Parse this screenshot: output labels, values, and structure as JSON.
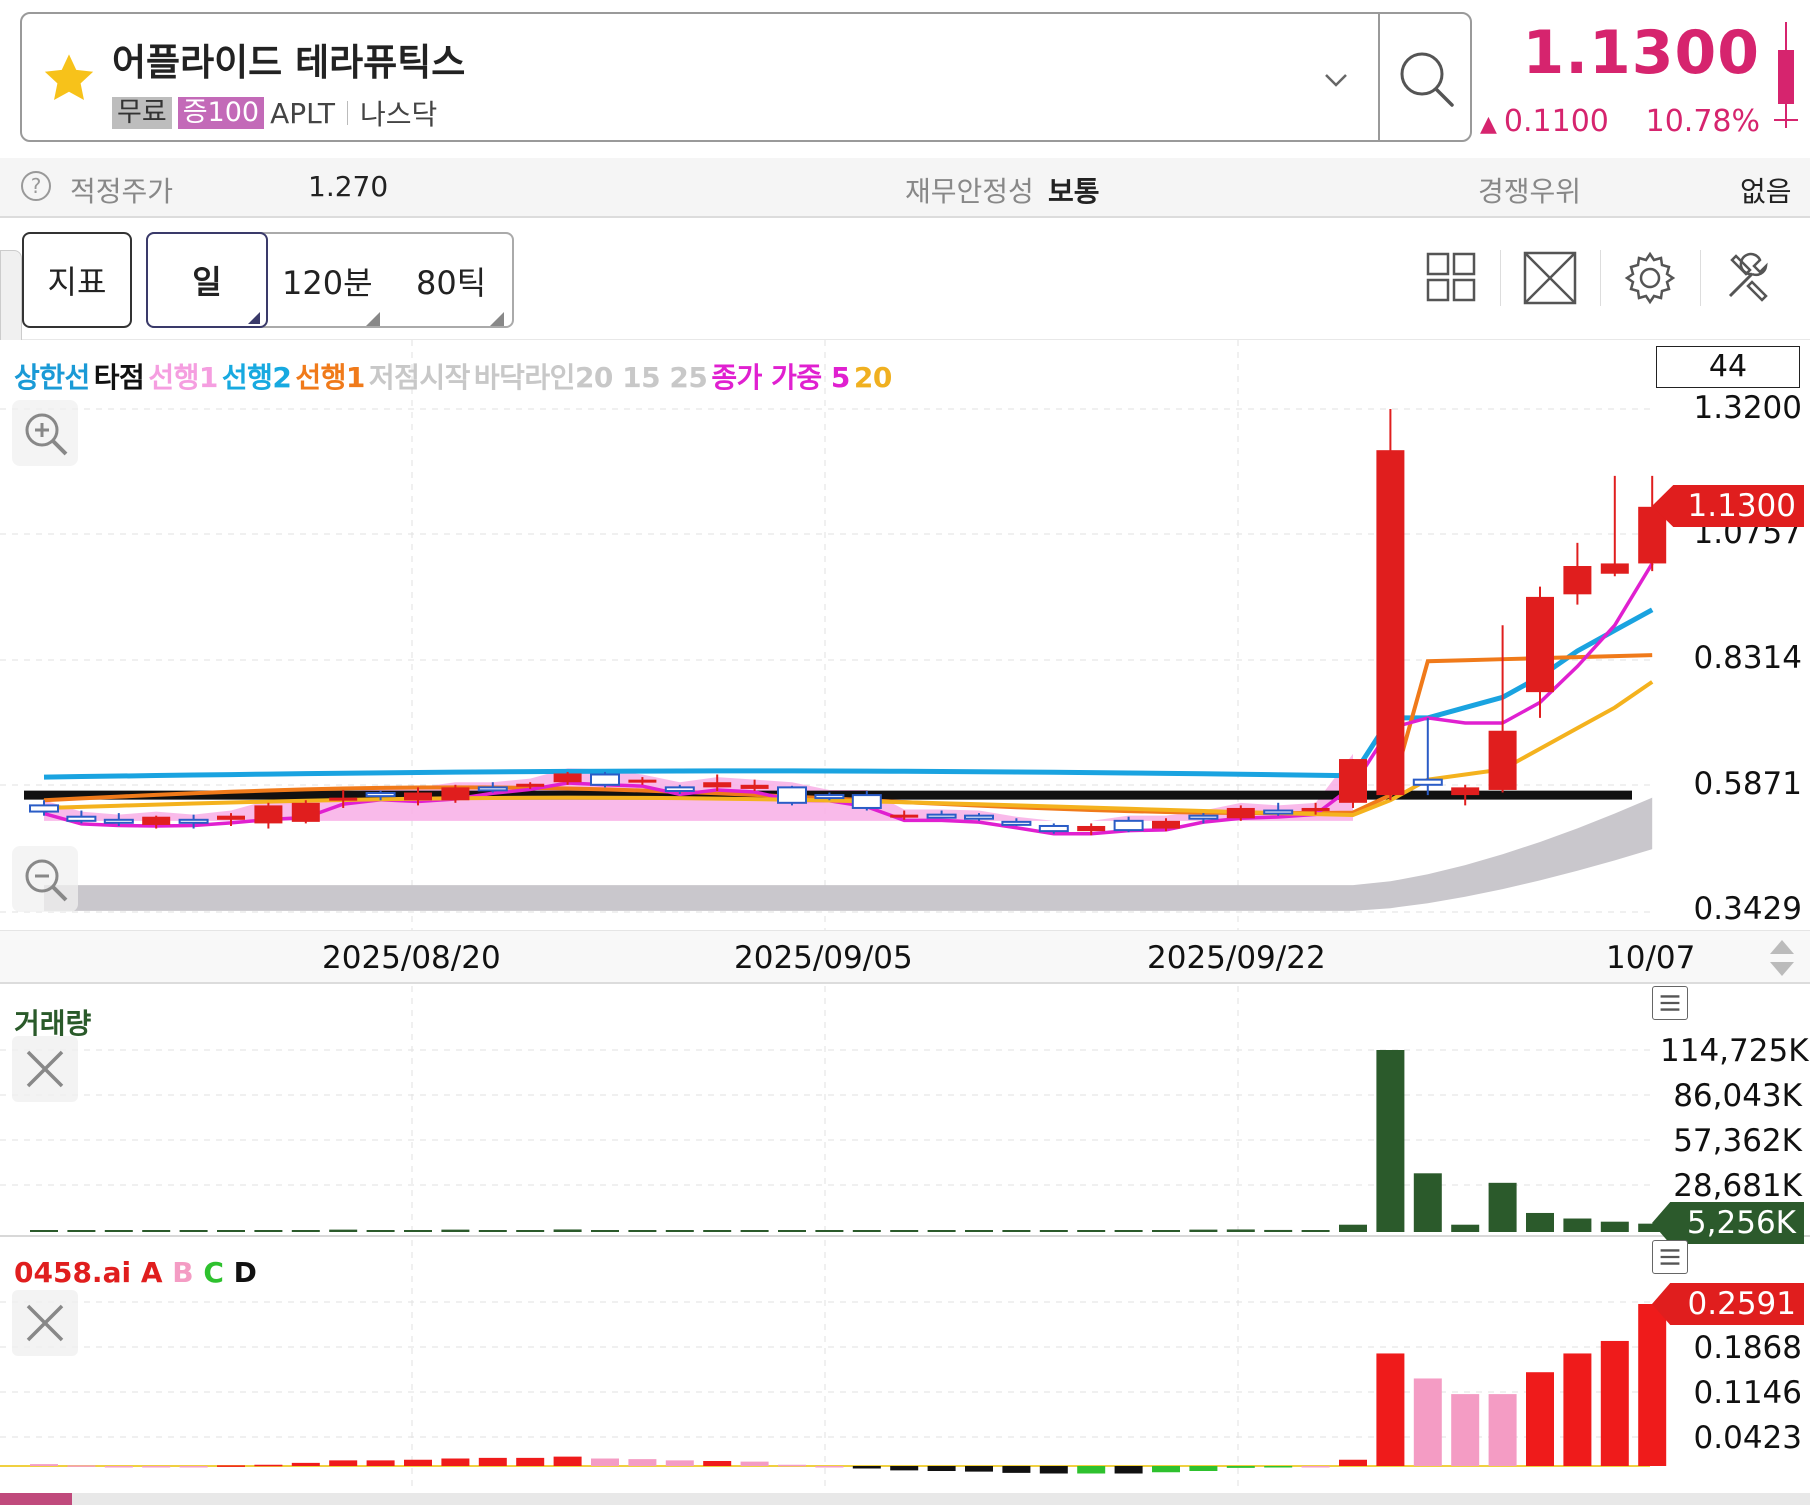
{
  "header": {
    "stock_name": "어플라이드 테라퓨틱스",
    "tag_free": "무료",
    "tag_margin": "증100",
    "ticker": "APLT",
    "market": "나스닥",
    "price": "1.1300",
    "change": "0.1100",
    "change_pct": "10.78%",
    "accent_color": "#d6246e"
  },
  "info_row": {
    "fair_price_label": "적정주가",
    "fair_price_value": "1.270",
    "financial_label": "재무안정성",
    "financial_value": "보통",
    "competition_label": "경쟁우위",
    "competition_value": "없음"
  },
  "toolbar": {
    "indicator_label": "지표",
    "period_day": "일",
    "period_120": "120분",
    "period_80": "80틱",
    "icons": [
      "layout-grid-icon",
      "fullscreen-icon",
      "gear-icon",
      "tools-icon"
    ]
  },
  "price_chart": {
    "legend": [
      {
        "text": "상한선",
        "color": "#1a9ad6"
      },
      {
        "text": "타점",
        "color": "#111111"
      },
      {
        "text": "선행1",
        "color": "#f59ee0"
      },
      {
        "text": "선행2",
        "color": "#17a9e0"
      },
      {
        "text": "선행1",
        "color": "#f07a1a"
      },
      {
        "text": "저점시작",
        "color": "#c8c8c8"
      },
      {
        "text": "바닥라인20 15 25",
        "color": "#c8c8c8"
      },
      {
        "text": "종가 가중 5",
        "color": "#e020d0"
      },
      {
        "text": "20",
        "color": "#f0b020"
      }
    ],
    "count_box": "44",
    "price_labels": [
      "1.3200",
      "1.0757",
      "0.8314",
      "0.5871",
      "0.3429"
    ],
    "current_flag": "1.1300",
    "dates": [
      "2025/08/20",
      "2025/09/05",
      "2025/09/22",
      "10/07"
    ]
  },
  "volume_chart": {
    "title": "거래량",
    "labels": [
      "114,725K",
      "86,043K",
      "57,362K",
      "28,681K"
    ],
    "current_flag": "5,256K"
  },
  "ai_chart": {
    "title_main": "0458.ai",
    "title_a": "A",
    "title_b": "B",
    "title_c": "C",
    "title_d": "D",
    "labels": [
      "0.1868",
      "0.1146",
      "0.0423"
    ],
    "current_flag": "0.2591"
  },
  "chart_data": [
    {
      "type": "candlestick",
      "ylim": [
        0.3429,
        1.32
      ],
      "candles": [
        {
          "o": 0.55,
          "h": 0.56,
          "l": 0.53,
          "c": 0.538,
          "dir": "down"
        },
        {
          "o": 0.528,
          "h": 0.54,
          "l": 0.515,
          "c": 0.52,
          "dir": "down"
        },
        {
          "o": 0.52,
          "h": 0.535,
          "l": 0.51,
          "c": 0.522,
          "dir": "down"
        },
        {
          "o": 0.512,
          "h": 0.53,
          "l": 0.505,
          "c": 0.528,
          "dir": "up"
        },
        {
          "o": 0.52,
          "h": 0.532,
          "l": 0.505,
          "c": 0.522,
          "dir": "down"
        },
        {
          "o": 0.522,
          "h": 0.535,
          "l": 0.51,
          "c": 0.53,
          "dir": "up"
        },
        {
          "o": 0.515,
          "h": 0.555,
          "l": 0.505,
          "c": 0.55,
          "dir": "up"
        },
        {
          "o": 0.518,
          "h": 0.56,
          "l": 0.515,
          "c": 0.555,
          "dir": "up"
        },
        {
          "o": 0.56,
          "h": 0.58,
          "l": 0.545,
          "c": 0.565,
          "dir": "up"
        },
        {
          "o": 0.568,
          "h": 0.578,
          "l": 0.56,
          "c": 0.574,
          "dir": "down"
        },
        {
          "o": 0.56,
          "h": 0.585,
          "l": 0.55,
          "c": 0.575,
          "dir": "up"
        },
        {
          "o": 0.56,
          "h": 0.59,
          "l": 0.555,
          "c": 0.585,
          "dir": "up"
        },
        {
          "o": 0.585,
          "h": 0.595,
          "l": 0.575,
          "c": 0.582,
          "dir": "down"
        },
        {
          "o": 0.59,
          "h": 0.595,
          "l": 0.582,
          "c": 0.592,
          "dir": "up"
        },
        {
          "o": 0.595,
          "h": 0.615,
          "l": 0.59,
          "c": 0.612,
          "dir": "up"
        },
        {
          "o": 0.61,
          "h": 0.615,
          "l": 0.585,
          "c": 0.59,
          "dir": "down"
        },
        {
          "o": 0.595,
          "h": 0.605,
          "l": 0.59,
          "c": 0.6,
          "dir": "up"
        },
        {
          "o": 0.578,
          "h": 0.59,
          "l": 0.572,
          "c": 0.585,
          "dir": "down"
        },
        {
          "o": 0.585,
          "h": 0.61,
          "l": 0.578,
          "c": 0.595,
          "dir": "up"
        },
        {
          "o": 0.582,
          "h": 0.6,
          "l": 0.578,
          "c": 0.59,
          "dir": "up"
        },
        {
          "o": 0.585,
          "h": 0.588,
          "l": 0.55,
          "c": 0.555,
          "dir": "down"
        },
        {
          "o": 0.57,
          "h": 0.575,
          "l": 0.56,
          "c": 0.568,
          "dir": "down"
        },
        {
          "o": 0.57,
          "h": 0.578,
          "l": 0.54,
          "c": 0.545,
          "dir": "down"
        },
        {
          "o": 0.53,
          "h": 0.54,
          "l": 0.522,
          "c": 0.532,
          "dir": "up"
        },
        {
          "o": 0.532,
          "h": 0.54,
          "l": 0.525,
          "c": 0.53,
          "dir": "down"
        },
        {
          "o": 0.53,
          "h": 0.535,
          "l": 0.52,
          "c": 0.525,
          "dir": "down"
        },
        {
          "o": 0.518,
          "h": 0.525,
          "l": 0.51,
          "c": 0.515,
          "dir": "down"
        },
        {
          "o": 0.51,
          "h": 0.515,
          "l": 0.495,
          "c": 0.5,
          "dir": "down"
        },
        {
          "o": 0.5,
          "h": 0.515,
          "l": 0.492,
          "c": 0.51,
          "dir": "up"
        },
        {
          "o": 0.52,
          "h": 0.528,
          "l": 0.498,
          "c": 0.502,
          "dir": "down"
        },
        {
          "o": 0.505,
          "h": 0.525,
          "l": 0.5,
          "c": 0.52,
          "dir": "up"
        },
        {
          "o": 0.525,
          "h": 0.535,
          "l": 0.515,
          "c": 0.53,
          "dir": "down"
        },
        {
          "o": 0.525,
          "h": 0.55,
          "l": 0.52,
          "c": 0.545,
          "dir": "up"
        },
        {
          "o": 0.535,
          "h": 0.555,
          "l": 0.53,
          "c": 0.54,
          "dir": "down"
        },
        {
          "o": 0.54,
          "h": 0.555,
          "l": 0.532,
          "c": 0.545,
          "dir": "up"
        },
        {
          "o": 0.555,
          "h": 0.64,
          "l": 0.545,
          "c": 0.64,
          "dir": "up"
        },
        {
          "o": 0.57,
          "h": 1.32,
          "l": 0.56,
          "c": 1.24,
          "dir": "up"
        },
        {
          "o": 0.59,
          "h": 0.72,
          "l": 0.57,
          "c": 0.6,
          "dir": "down"
        },
        {
          "o": 0.57,
          "h": 0.59,
          "l": 0.55,
          "c": 0.585,
          "dir": "up"
        },
        {
          "o": 0.58,
          "h": 0.9,
          "l": 0.575,
          "c": 0.695,
          "dir": "up"
        },
        {
          "o": 0.77,
          "h": 0.975,
          "l": 0.72,
          "c": 0.955,
          "dir": "up"
        },
        {
          "o": 0.96,
          "h": 1.06,
          "l": 0.94,
          "c": 1.015,
          "dir": "up"
        },
        {
          "o": 1.0,
          "h": 1.19,
          "l": 0.995,
          "c": 1.02,
          "dir": "up"
        },
        {
          "o": 1.02,
          "h": 1.19,
          "l": 1.005,
          "c": 1.13,
          "dir": "up"
        }
      ]
    },
    {
      "type": "bar",
      "title": "거래량",
      "unit": "K",
      "ylim": [
        0,
        114725
      ],
      "values": [
        800,
        800,
        800,
        800,
        800,
        800,
        900,
        900,
        1500,
        1200,
        1200,
        1500,
        1000,
        1200,
        1600,
        1200,
        900,
        900,
        1200,
        1000,
        900,
        900,
        900,
        900,
        900,
        900,
        900,
        900,
        1000,
        1100,
        1200,
        1500,
        1600,
        1300,
        1200,
        4600,
        114725,
        37000,
        4600,
        31000,
        12000,
        8500,
        6500,
        5256
      ]
    },
    {
      "type": "bar",
      "title": "0458.ai",
      "ylim": [
        0,
        0.2591
      ],
      "values": [
        0.003,
        0.001,
        0.0,
        0.0,
        0.0,
        0.001,
        0.002,
        0.005,
        0.009,
        0.009,
        0.01,
        0.012,
        0.013,
        0.013,
        0.015,
        0.012,
        0.011,
        0.009,
        0.008,
        0.007,
        0.002,
        0.0,
        -0.004,
        -0.007,
        -0.008,
        -0.009,
        -0.011,
        -0.012,
        -0.012,
        -0.012,
        -0.01,
        -0.008,
        -0.003,
        -0.002,
        0.0,
        0.01,
        0.18,
        0.14,
        0.115,
        0.115,
        0.15,
        0.18,
        0.2,
        0.2591
      ],
      "colors": [
        "#f49cc4",
        "#f49cc4",
        "#f49cc4",
        "#f49cc4",
        "#f49cc4",
        "#ef1b1b",
        "#ef1b1b",
        "#ef1b1b",
        "#ef1b1b",
        "#ef1b1b",
        "#ef1b1b",
        "#ef1b1b",
        "#ef1b1b",
        "#ef1b1b",
        "#ef1b1b",
        "#f49cc4",
        "#f49cc4",
        "#f49cc4",
        "#ef1b1b",
        "#f49cc4",
        "#f49cc4",
        "#f49cc4",
        "#111111",
        "#111111",
        "#111111",
        "#111111",
        "#111111",
        "#111111",
        "#2ec12e",
        "#111111",
        "#2ec12e",
        "#2ec12e",
        "#2ec12e",
        "#2ec12e",
        "#f49cc4",
        "#ef1b1b",
        "#ef1b1b",
        "#f49cc4",
        "#f49cc4",
        "#f49cc4",
        "#ef1b1b",
        "#ef1b1b",
        "#ef1b1b",
        "#ef1b1b"
      ]
    }
  ]
}
